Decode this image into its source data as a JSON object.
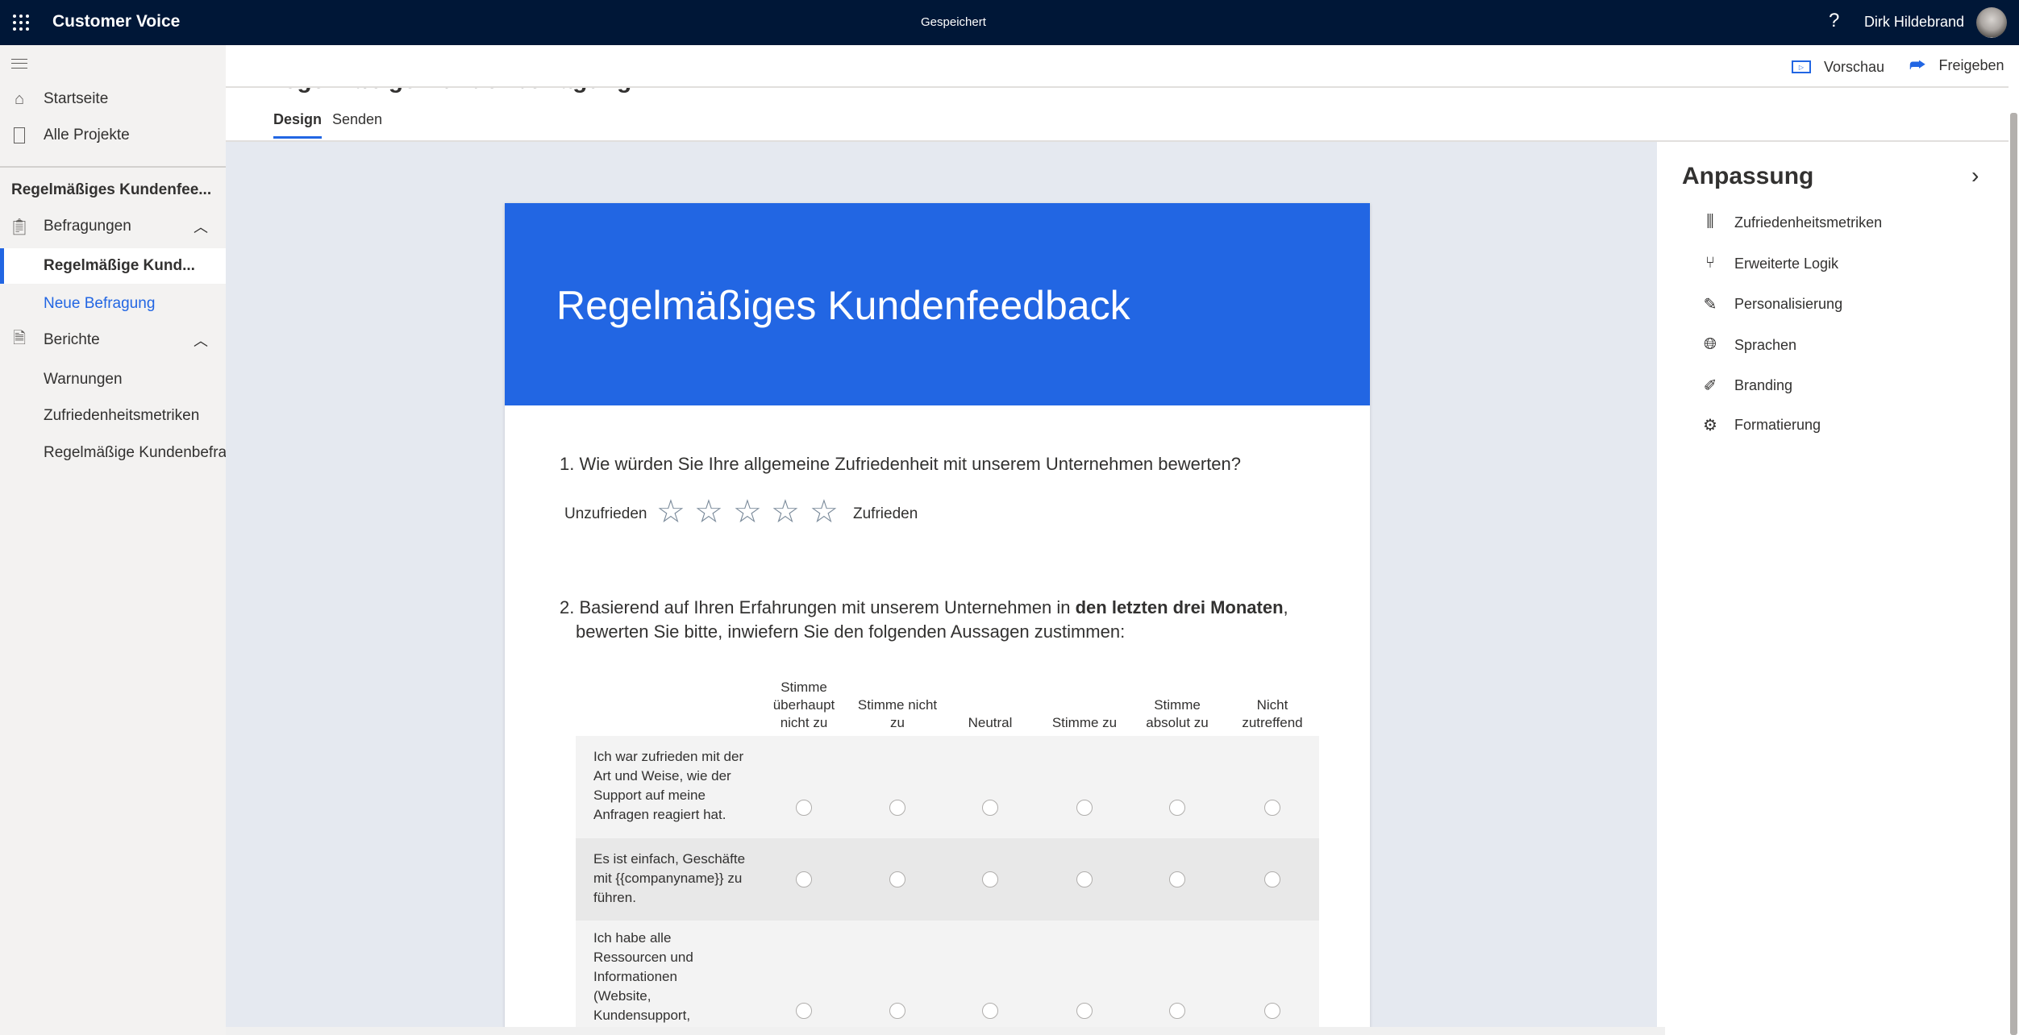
{
  "topbar": {
    "app_name": "Customer Voice",
    "status": "Gespeichert",
    "help": "?",
    "user_name": "Dirk Hildebrand"
  },
  "sidebar": {
    "items": [
      {
        "label": "Startseite",
        "icon": "home-icon"
      },
      {
        "label": "Alle Projekte",
        "icon": "projects-icon"
      }
    ],
    "project_title": "Regelmäßiges Kundenfee...",
    "surveys": {
      "label": "Befragungen",
      "items": [
        "Regelmäßige Kund...",
        "Neue Befragung"
      ]
    },
    "reports": {
      "label": "Berichte",
      "items": [
        "Warnungen",
        "Zufriedenheitsmetriken",
        "Regelmäßige Kundenbefra..."
      ]
    }
  },
  "commandbar": {
    "preview": "Vorschau",
    "share": "Freigeben"
  },
  "page": {
    "title": "Regelmäßige Kundenbefragung",
    "tabs": [
      "Design",
      "Senden"
    ],
    "active_tab": "Design"
  },
  "survey": {
    "title": "Regelmäßiges Kundenfeedback",
    "header_color": "#2266e3",
    "q1": {
      "number": "1.",
      "text": "Wie würden Sie Ihre allgemeine Zufriedenheit mit unserem Unternehmen bewerten?",
      "low": "Unzufrieden",
      "high": "Zufrieden",
      "stars": 5
    },
    "q2": {
      "number": "2.",
      "text_a": "Basierend auf Ihren Erfahrungen mit unserem Unternehmen in ",
      "text_bold": "den letzten drei Monaten",
      "text_b": ",",
      "text_line2": "bewerten Sie bitte, inwiefern Sie den folgenden Aussagen zustimmen:",
      "columns": [
        "Stimme überhaupt nicht zu",
        "Stimme nicht zu",
        "Neutral",
        "Stimme zu",
        "Stimme absolut zu",
        "Nicht zutreffend"
      ],
      "rows": [
        "Ich war zufrieden mit der Art und Weise, wie der Support auf meine Anfragen reagiert hat.",
        "Es ist einfach, Geschäfte mit {{companyname}} zu führen.",
        "Ich habe alle Ressourcen und Informationen (Website, Kundensupport, Social"
      ]
    }
  },
  "panel": {
    "title": "Anpassung",
    "items": [
      "Zufriedenheitsmetriken",
      "Erweiterte Logik",
      "Personalisierung",
      "Sprachen",
      "Branding",
      "Formatierung"
    ]
  }
}
